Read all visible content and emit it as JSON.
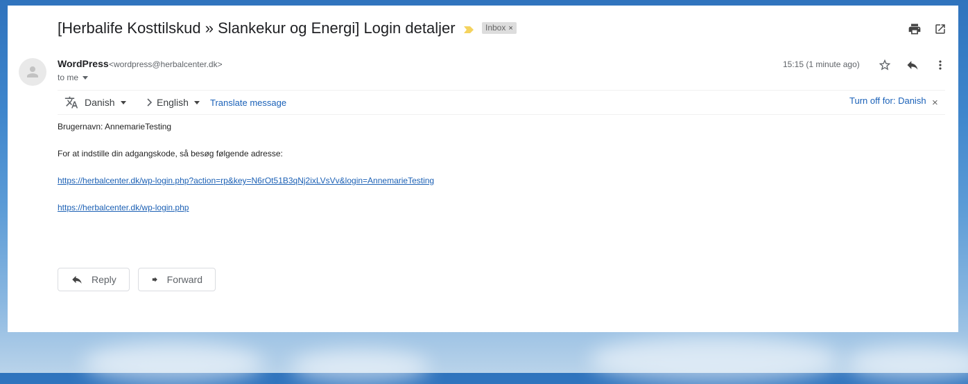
{
  "email": {
    "subject": "[Herbalife Kosttilskud » Slankekur og Energi] Login detaljer",
    "label": "Inbox",
    "label_remove": "×"
  },
  "sender": {
    "name": "WordPress",
    "email": "<wordpress@herbalcenter.dk>",
    "recipient": "to me",
    "timestamp": "15:15 (1 minute ago)"
  },
  "translate": {
    "source_language": "Danish",
    "target_language": "English",
    "translate_link": "Translate message",
    "turn_off_link": "Turn off for: Danish",
    "dismiss": "×"
  },
  "body": {
    "username_line": "Brugernavn: AnnemarieTesting",
    "instruction_line": "For at indstille din adgangskode, så besøg følgende adresse:",
    "reset_link": "https://herbalcenter.dk/wp-login.php?action=rp&key=N6rOt51B3qNj2ixLVsVv&login=AnnemarieTesting",
    "login_link": "https://herbalcenter.dk/wp-login.php"
  },
  "actions": {
    "reply_label": "Reply",
    "forward_label": "Forward"
  },
  "colors": {
    "link": "#1a5fb4",
    "importance_marker": "#f4d35e",
    "label_bg": "#dddddd"
  },
  "icons": [
    "print-icon",
    "open-new-window-icon",
    "star-icon",
    "reply-icon",
    "more-vert-icon",
    "translate-icon",
    "chevron-right-icon",
    "forward-icon",
    "avatar-person-icon",
    "importance-marker-icon"
  ]
}
